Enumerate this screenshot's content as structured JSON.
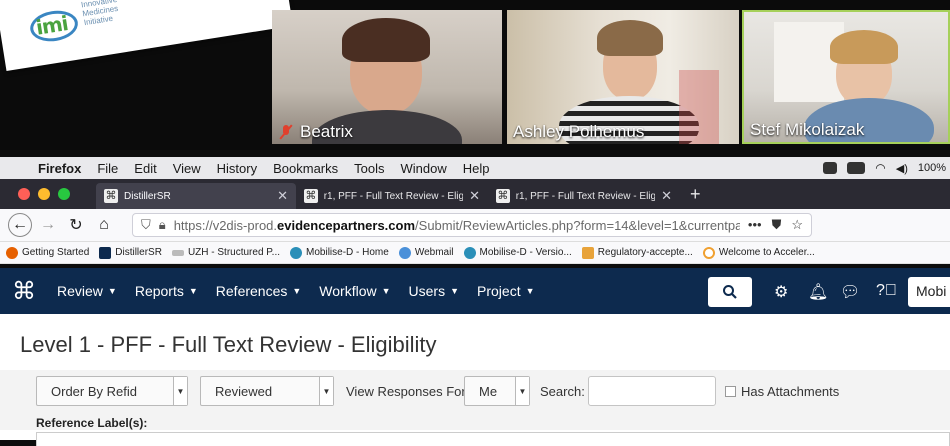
{
  "logo": {
    "mark": "imi",
    "subtitle_lines": [
      "Innovative",
      "Medicines",
      "Initiative"
    ]
  },
  "participants": [
    {
      "name": "Beatrix",
      "muted": true
    },
    {
      "name": "Ashley Polhemus",
      "muted": false
    },
    {
      "name": "Stef Mikolaizak",
      "muted": false,
      "active_speaker": true
    }
  ],
  "menubar": {
    "app": "Firefox",
    "items": [
      "File",
      "Edit",
      "View",
      "History",
      "Bookmarks",
      "Tools",
      "Window",
      "Help"
    ],
    "battery": "100%"
  },
  "browser": {
    "tabs": [
      {
        "title": "DistillerSR",
        "active": true
      },
      {
        "title": "r1, PFF - Full Text Review - Eligi",
        "active": false
      },
      {
        "title": "r1, PFF - Full Text Review - Eligi",
        "active": false
      }
    ],
    "url": {
      "prefix": "https://v2dis-prod.",
      "host": "evidencepartners.com",
      "path": "/Submit/ReviewArticles.php?form=14&level=1&currentpag"
    },
    "bookmarks": [
      {
        "label": "Getting Started",
        "color": "#e66000"
      },
      {
        "label": "DistillerSR",
        "color": "#0d2a4e"
      },
      {
        "label": "UZH - Structured P...",
        "color": "#bbbbbb"
      },
      {
        "label": "Mobilise-D - Home",
        "color": "#2a8fb8"
      },
      {
        "label": "Webmail",
        "color": "#4a90d9"
      },
      {
        "label": "Mobilise-D - Versio...",
        "color": "#2a8fb8"
      },
      {
        "label": "Regulatory-accepte...",
        "color": "#e8a33a"
      },
      {
        "label": "Welcome to Acceler...",
        "color": "#f0a030"
      }
    ]
  },
  "app_nav": {
    "logo_glyph": "⌘",
    "items": [
      "Review",
      "Reports",
      "References",
      "Workflow",
      "Users",
      "Project"
    ],
    "user_button": "Mobi"
  },
  "page": {
    "title": "Level 1 - PFF - Full Text Review - Eligibility",
    "order_select": "Order By Refid",
    "status_select": "Reviewed",
    "view_responses_label": "View Responses For:",
    "view_responses_value": "Me",
    "search_label": "Search:",
    "search_value": "",
    "attachments_label": "Has Attachments",
    "reference_label": "Reference Label(s):"
  }
}
